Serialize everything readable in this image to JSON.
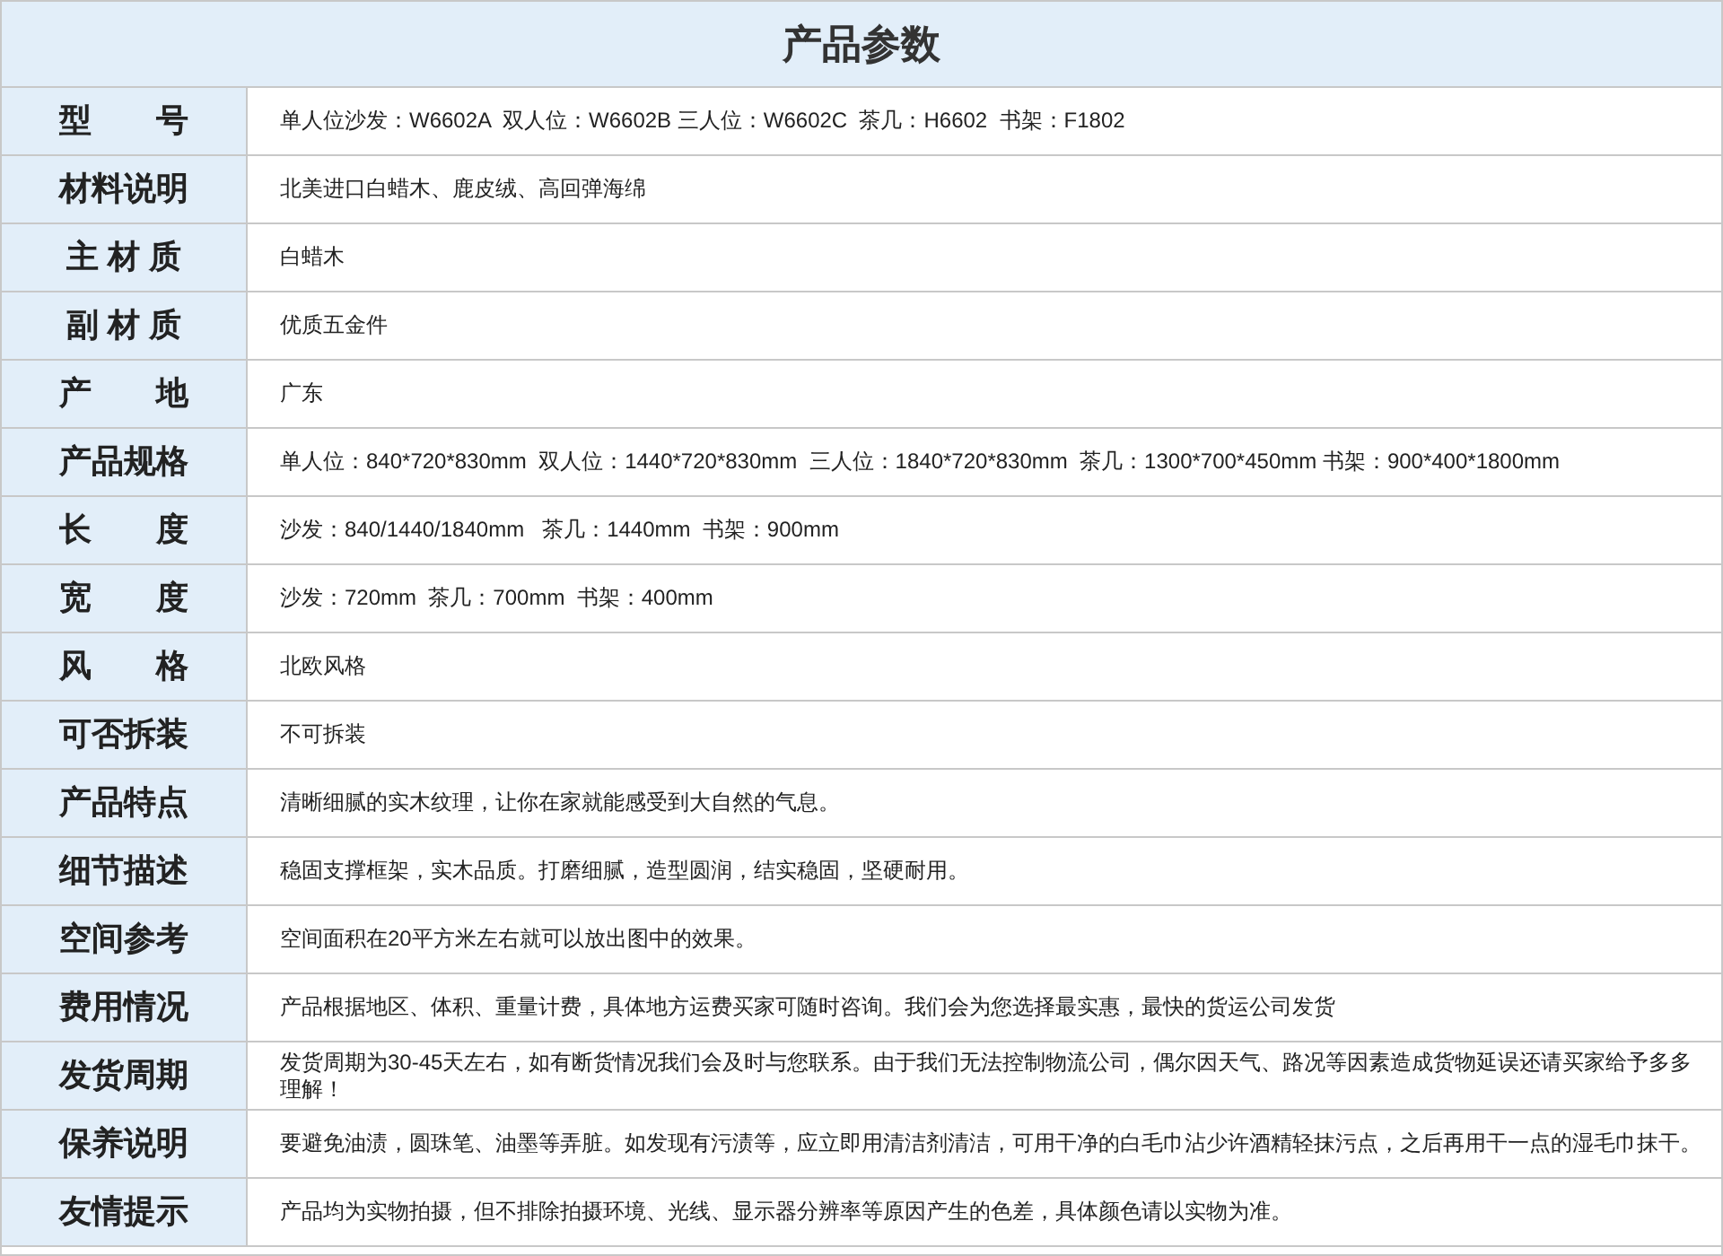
{
  "title": "产品参数",
  "rows": [
    {
      "label": "型　　号",
      "value": "单人位沙发：W6602A  双人位：W6602B 三人位：W6602C  茶几：H6602  书架：F1802"
    },
    {
      "label": "材料说明",
      "value": "北美进口白蜡木、鹿皮绒、高回弹海绵"
    },
    {
      "label": "主 材 质",
      "value": "白蜡木"
    },
    {
      "label": "副 材 质",
      "value": "优质五金件"
    },
    {
      "label": "产　　地",
      "value": "广东"
    },
    {
      "label": "产品规格",
      "value": "单人位：840*720*830mm  双人位：1440*720*830mm  三人位：1840*720*830mm  茶几：1300*700*450mm 书架：900*400*1800mm"
    },
    {
      "label": "长　　度",
      "value": "沙发：840/1440/1840mm   茶几：1440mm  书架：900mm"
    },
    {
      "label": "宽　　度",
      "value": "沙发：720mm  茶几：700mm  书架：400mm"
    },
    {
      "label": "风　　格",
      "value": "北欧风格"
    },
    {
      "label": "可否拆装",
      "value": "不可拆装"
    },
    {
      "label": "产品特点",
      "value": "清晰细腻的实木纹理，让你在家就能感受到大自然的气息。"
    },
    {
      "label": "细节描述",
      "value": "稳固支撑框架，实木品质。打磨细腻，造型圆润，结实稳固，坚硬耐用。"
    },
    {
      "label": "空间参考",
      "value": "空间面积在20平方米左右就可以放出图中的效果。"
    },
    {
      "label": "费用情况",
      "value": "产品根据地区、体积、重量计费，具体地方运费买家可随时咨询。我们会为您选择最实惠，最快的货运公司发货"
    },
    {
      "label": "发货周期",
      "value": "发货周期为30-45天左右，如有断货情况我们会及时与您联系。由于我们无法控制物流公司，偶尔因天气、路况等因素造成货物延误还请买家给予多多理解！"
    },
    {
      "label": "保养说明",
      "value": "要避免油渍，圆珠笔、油墨等弄脏。如发现有污渍等，应立即用清洁剂清洁，可用干净的白毛巾沾少许酒精轻抹污点，之后再用干一点的湿毛巾抹干。"
    },
    {
      "label": "友情提示",
      "value": "产品均为实物拍摄，但不排除拍摄环境、光线、显示器分辨率等原因产生的色差，具体颜色请以实物为准。"
    }
  ]
}
